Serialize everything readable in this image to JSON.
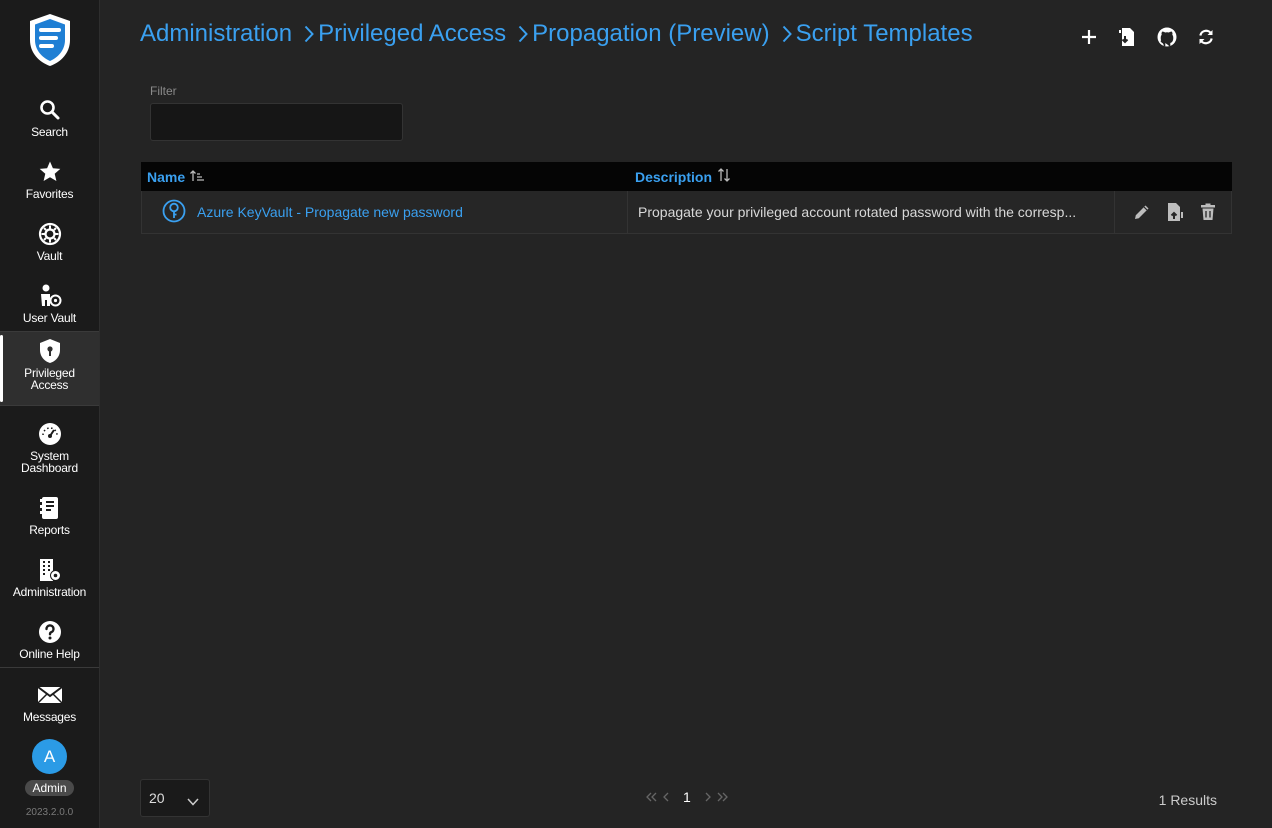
{
  "sidebar": {
    "items": [
      {
        "label": "Search",
        "icon": "search-icon"
      },
      {
        "label": "Favorites",
        "icon": "star-icon"
      },
      {
        "label": "Vault",
        "icon": "vault-icon"
      },
      {
        "label": "User Vault",
        "icon": "user-vault-icon"
      },
      {
        "label": "Privileged Access",
        "icon": "shield-lock-icon",
        "active": true
      },
      {
        "label": "System Dashboard",
        "icon": "dashboard-gauge-icon"
      },
      {
        "label": "Reports",
        "icon": "reports-icon"
      },
      {
        "label": "Administration",
        "icon": "building-gear-icon"
      },
      {
        "label": "Online Help",
        "icon": "help-icon"
      },
      {
        "label": "Messages",
        "icon": "envelope-icon"
      }
    ],
    "user": {
      "initial": "A",
      "role": "Admin"
    },
    "version": "2023.2.0.0"
  },
  "breadcrumb": [
    "Administration",
    "Privileged Access",
    "Propagation (Preview)",
    "Script Templates"
  ],
  "toolbar": {
    "icons": [
      "add-icon",
      "import-file-icon",
      "github-icon",
      "refresh-icon"
    ]
  },
  "filter": {
    "label": "Filter",
    "value": "",
    "placeholder": ""
  },
  "table": {
    "columns": [
      {
        "label": "Name",
        "sort": "ascending"
      },
      {
        "label": "Description",
        "sort": "none"
      }
    ],
    "rows": [
      {
        "name": "Azure KeyVault - Propagate new password",
        "description": "Propagate your privileged account rotated password with the corresp...",
        "actions": [
          "edit-icon",
          "export-file-icon",
          "delete-icon"
        ]
      }
    ]
  },
  "pagination": {
    "page_size": "20",
    "current_page": "1",
    "results": "1 Results"
  },
  "colors": {
    "accent": "#3aa0f0",
    "background": "#242424",
    "sidebar": "#1b1b1b",
    "avatar": "#2b9be6"
  }
}
